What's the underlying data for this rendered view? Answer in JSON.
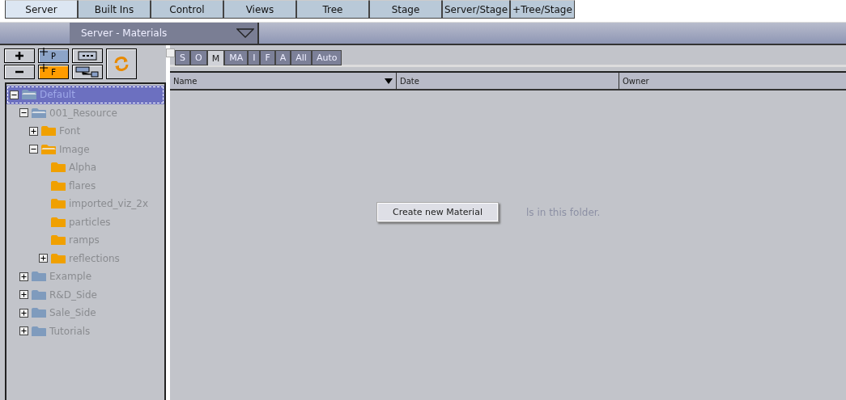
{
  "tabs": [
    {
      "label": "Server",
      "selected": true
    },
    {
      "label": "Built Ins",
      "selected": false
    },
    {
      "label": "Control",
      "selected": false
    },
    {
      "label": "Views",
      "selected": false
    },
    {
      "label": "Tree",
      "selected": false
    },
    {
      "label": "Stage",
      "selected": false
    },
    {
      "label": "Server/Stage",
      "selected": false
    },
    {
      "label": "+Tree/Stage",
      "selected": false
    }
  ],
  "view_dropdown": {
    "value": "Server - Materials"
  },
  "toolbar": {
    "add_p_label": "P",
    "add_f_label": "F"
  },
  "tree": [
    {
      "label": "Default",
      "kind": "branch",
      "expanded": true,
      "selected": true,
      "color": "#7f9bbd",
      "children": [
        {
          "label": "001_Resource",
          "kind": "branch",
          "expanded": true,
          "selected": false,
          "color": "#7f9bbd",
          "children": [
            {
              "label": "Font",
              "kind": "branch",
              "expanded": false,
              "selected": false,
              "color": "#f0a000"
            },
            {
              "label": "Image",
              "kind": "branch",
              "expanded": true,
              "selected": false,
              "color": "#f0a000",
              "children": [
                {
                  "label": "Alpha",
                  "kind": "leaf",
                  "selected": false,
                  "color": "#f0a000"
                },
                {
                  "label": "flares",
                  "kind": "leaf",
                  "selected": false,
                  "color": "#f0a000"
                },
                {
                  "label": "imported_viz_2x",
                  "kind": "leaf",
                  "selected": false,
                  "color": "#f0a000"
                },
                {
                  "label": "particles",
                  "kind": "leaf",
                  "selected": false,
                  "color": "#f0a000"
                },
                {
                  "label": "ramps",
                  "kind": "leaf",
                  "selected": false,
                  "color": "#f0a000"
                },
                {
                  "label": "reflections",
                  "kind": "branch",
                  "expanded": false,
                  "selected": false,
                  "color": "#f0a000"
                }
              ]
            }
          ]
        },
        {
          "label": "Example",
          "kind": "branch",
          "expanded": false,
          "selected": false,
          "color": "#7f9bbd"
        },
        {
          "label": "R&D_Side",
          "kind": "branch",
          "expanded": false,
          "selected": false,
          "color": "#7f9bbd"
        },
        {
          "label": "Sale_Side",
          "kind": "branch",
          "expanded": false,
          "selected": false,
          "color": "#7f9bbd"
        },
        {
          "label": "Tutorials",
          "kind": "branch",
          "expanded": false,
          "selected": false,
          "color": "#7f9bbd"
        }
      ]
    }
  ],
  "filter_tabs": [
    {
      "label": "S",
      "selected": false
    },
    {
      "label": "O",
      "selected": false
    },
    {
      "label": "M",
      "selected": true
    },
    {
      "label": "MA",
      "selected": false
    },
    {
      "label": "I",
      "selected": false
    },
    {
      "label": "F",
      "selected": false
    },
    {
      "label": "A",
      "selected": false
    },
    {
      "label": "All",
      "selected": false
    },
    {
      "label": "Auto",
      "selected": false
    }
  ],
  "table": {
    "columns": [
      {
        "label": "Name",
        "sorted": true
      },
      {
        "label": "Date",
        "sorted": false
      },
      {
        "label": "Owner",
        "sorted": false
      }
    ],
    "empty_message": "ls in this folder."
  },
  "context_menu": {
    "items": [
      "Create new Material"
    ]
  }
}
